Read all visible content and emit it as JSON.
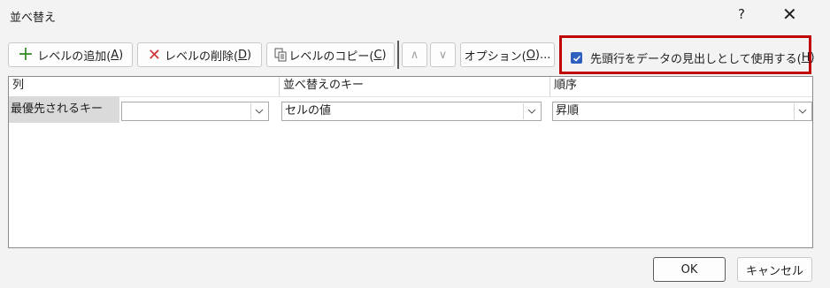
{
  "window": {
    "title": "並べ替え",
    "help_label": "?",
    "close_label": "✕"
  },
  "toolbar": {
    "add_level": {
      "label": "レベルの追加(",
      "key": "A",
      "suffix": ")"
    },
    "delete_level": {
      "label": "レベルの削除(",
      "key": "D",
      "suffix": ")"
    },
    "copy_level": {
      "label": "レベルのコピー(",
      "key": "C",
      "suffix": ")"
    },
    "move_up_label": "∧",
    "move_down_label": "∨",
    "options": {
      "label": "オプション(",
      "key": "O",
      "suffix": ")..."
    },
    "header_checkbox": {
      "label": "先頭行をデータの見出しとして使用する(",
      "key": "H",
      "suffix": ")",
      "checked": true
    }
  },
  "grid": {
    "headers": {
      "column": "列",
      "sort_on": "並べ替えのキー",
      "order": "順序"
    },
    "rows": [
      {
        "label": "最優先されるキー",
        "column_value": "",
        "sort_on_value": "セルの値",
        "order_value": "昇順"
      }
    ]
  },
  "footer": {
    "ok_label": "OK",
    "cancel_label": "キャンセル"
  },
  "colors": {
    "highlight_border": "#c00000",
    "checkbox_fill": "#2f5fbf",
    "add_icon": "#3a8f2c",
    "delete_icon": "#d13438"
  }
}
